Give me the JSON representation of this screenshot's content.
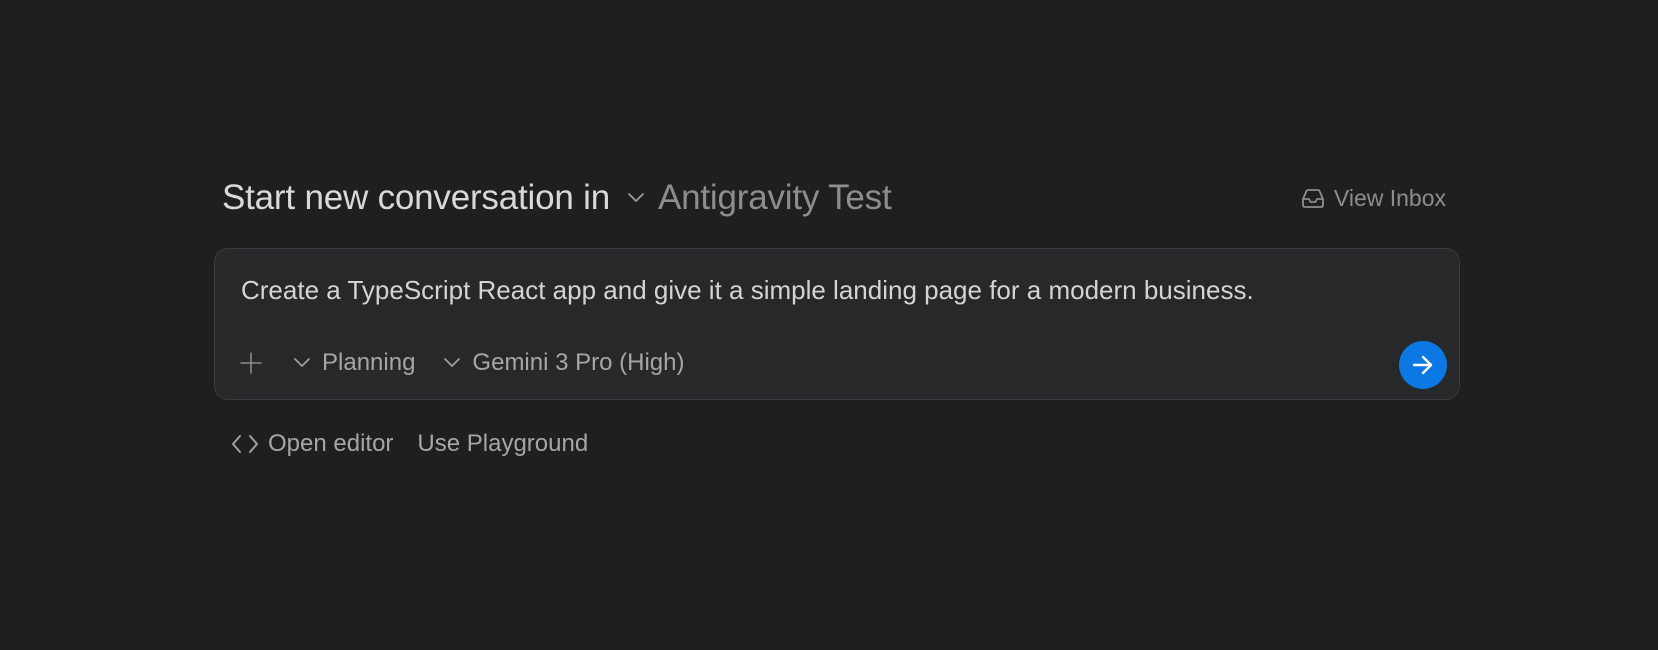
{
  "header": {
    "title": "Start new conversation in",
    "workspace": "Antigravity Test",
    "workspace_icon": "chevron-down-icon",
    "inbox_label": "View Inbox",
    "inbox_icon": "inbox-icon"
  },
  "composer": {
    "prompt": "Create a TypeScript React app and give it a simple landing page for a modern business.",
    "attach_icon": "plus-icon",
    "mode_label": "Planning",
    "model_label": "Gemini 3 Pro (High)",
    "send_icon": "arrow-right-icon"
  },
  "footer": {
    "open_editor_label": "Open editor",
    "open_editor_icon": "code-brackets-icon",
    "playground_label": "Use Playground"
  },
  "colors": {
    "background": "#1f1f1f",
    "composer_bg": "#27282a",
    "composer_border": "#3a3b3e",
    "send_button": "#0b78e3",
    "text_primary": "#d9d9d9",
    "text_secondary": "#8d8d8d"
  }
}
